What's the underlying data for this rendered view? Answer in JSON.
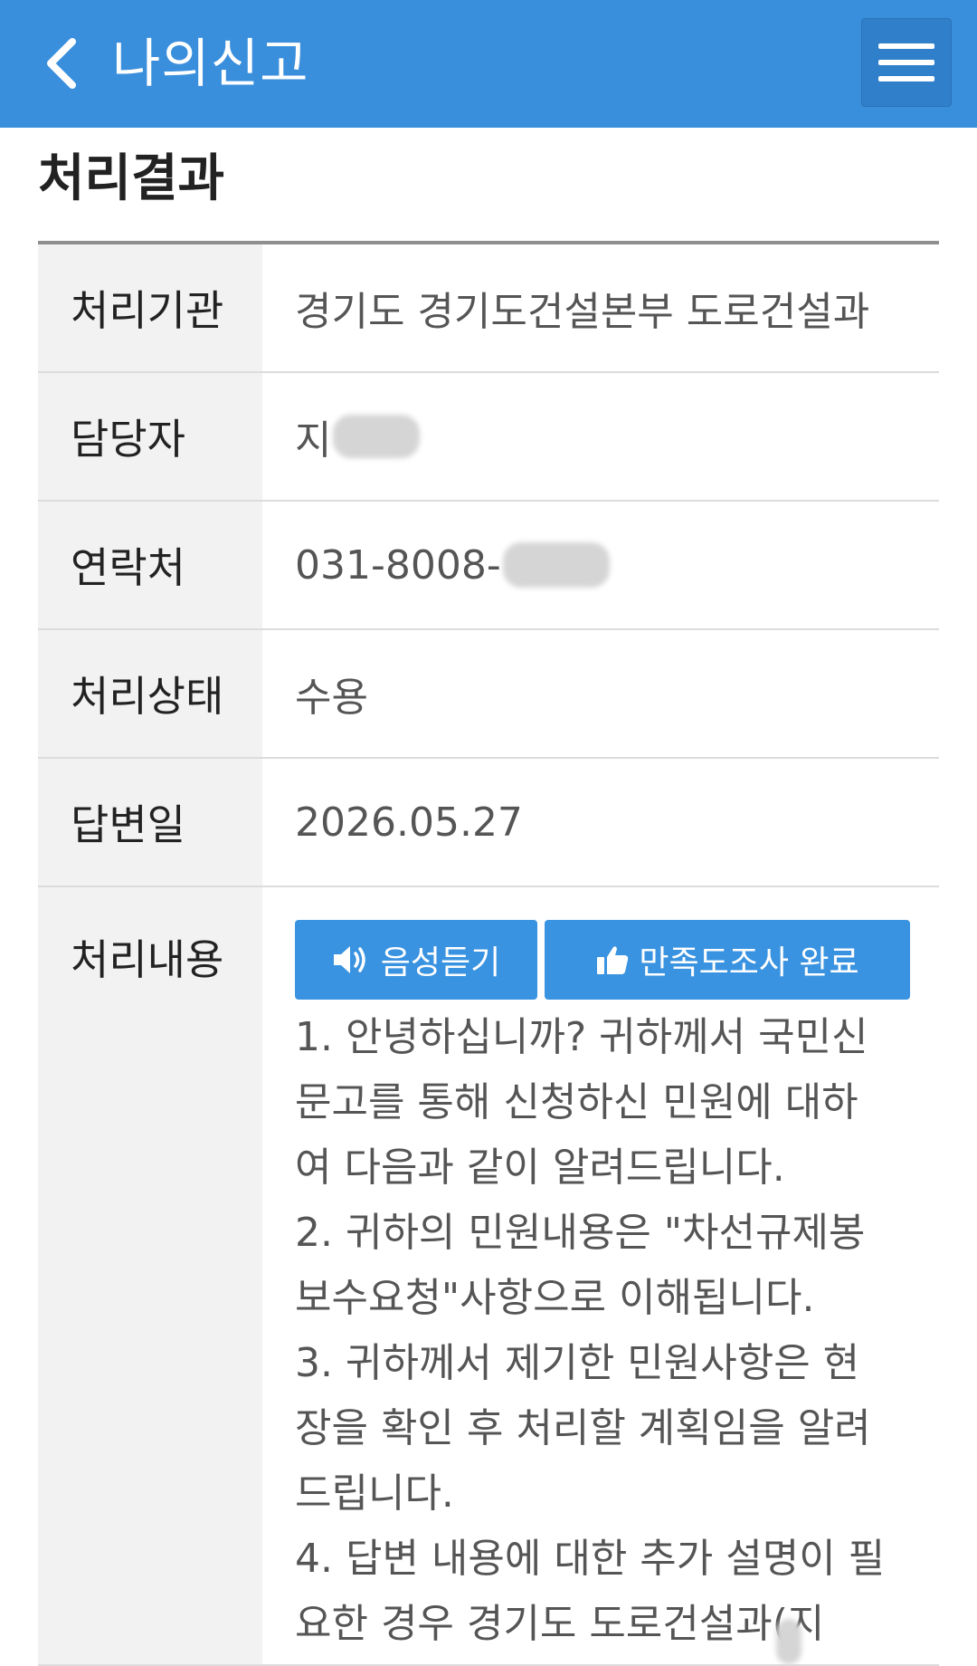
{
  "header": {
    "title": "나의신고"
  },
  "section": {
    "title": "처리결과"
  },
  "rows": {
    "agency": {
      "label": "처리기관",
      "value": "경기도 경기도건설본부 도로건설과"
    },
    "manager": {
      "label": "담당자",
      "value": "지"
    },
    "contact": {
      "label": "연락처",
      "value": "031-8008-"
    },
    "status": {
      "label": "처리상태",
      "value": "수용"
    },
    "answer_date": {
      "label": "답변일",
      "value": "2026.05.27"
    },
    "content": {
      "label": "처리내용",
      "voice_button": "음성듣기",
      "survey_button": "만족도조사 완료",
      "text": "1. 안녕하십니까? 귀하께서 국민신\n문고를 통해 신청하신 민원에 대하\n여 다음과 같이 알려드립니다.\n2. 귀하의 민원내용은 \"차선규제봉\n보수요청\"사항으로 이해됩니다.\n3. 귀하께서 제기한 민원사항은 현\n장을 확인 후 처리할 계획임을 알려\n드립니다.\n4. 답변 내용에 대한 추가 설명이 필\n요한 경우 경기도 도로건설과(지"
    }
  },
  "colors": {
    "appbar": "#3a8fdc",
    "accent": "#2c86d6",
    "button": "#3a93e0"
  },
  "icons": {
    "back": "chevron-left-icon",
    "menu": "hamburger-menu-icon",
    "voice": "speaker-icon",
    "survey": "thumbs-up-icon"
  }
}
